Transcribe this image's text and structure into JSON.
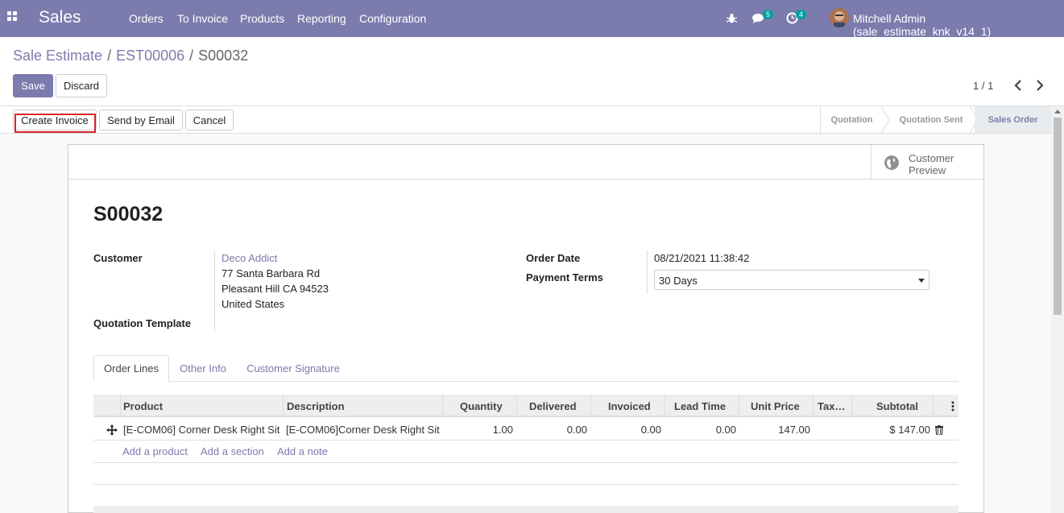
{
  "navbar": {
    "app_name": "Sales",
    "menu": [
      "Orders",
      "To Invoice",
      "Products",
      "Reporting",
      "Configuration"
    ],
    "messages_count": "5",
    "activities_count": "4",
    "user": "Mitchell Admin (sale_estimate_knk_v14_1)"
  },
  "breadcrumb": {
    "root": "Sale Estimate",
    "parent": "EST00006",
    "current": "S00032",
    "separator": "/"
  },
  "actions": {
    "save": "Save",
    "discard": "Discard"
  },
  "pager": {
    "value": "1 / 1"
  },
  "statusbar": {
    "buttons": [
      "Create Invoice",
      "Send by Email",
      "Cancel"
    ],
    "stages": [
      "Quotation",
      "Quotation Sent",
      "Sales Order"
    ],
    "current_stage": "Sales Order"
  },
  "buttonbox": {
    "customer_preview_line1": "Customer",
    "customer_preview_line2": "Preview"
  },
  "form": {
    "title": "S00032",
    "customer_label": "Customer",
    "customer_name": "Deco Addict",
    "address_line1": "77 Santa Barbara Rd",
    "address_line2": "Pleasant Hill CA 94523",
    "address_line3": "United States",
    "quotation_template_label": "Quotation Template",
    "order_date_label": "Order Date",
    "order_date": "08/21/2021 11:38:42",
    "payment_terms_label": "Payment Terms",
    "payment_terms": "30 Days"
  },
  "tabs": [
    "Order Lines",
    "Other Info",
    "Customer Signature"
  ],
  "order_lines": {
    "columns": [
      "Product",
      "Description",
      "Quantity",
      "Delivered",
      "Invoiced",
      "Lead Time",
      "Unit Price",
      "Tax…",
      "Subtotal"
    ],
    "rows": [
      {
        "product": "[E-COM06] Corner Desk Right Sit",
        "description": "[E-COM06]Corner Desk Right Sit",
        "quantity": "1.00",
        "delivered": "0.00",
        "invoiced": "0.00",
        "lead_time": "0.00",
        "unit_price": "147.00",
        "taxes": "",
        "subtotal": "$ 147.00"
      }
    ],
    "add_links": [
      "Add a product",
      "Add a section",
      "Add a note"
    ]
  },
  "colors": {
    "brand": "#7c7bad",
    "badge": "#00a09d",
    "highlight": "#d9232d"
  }
}
